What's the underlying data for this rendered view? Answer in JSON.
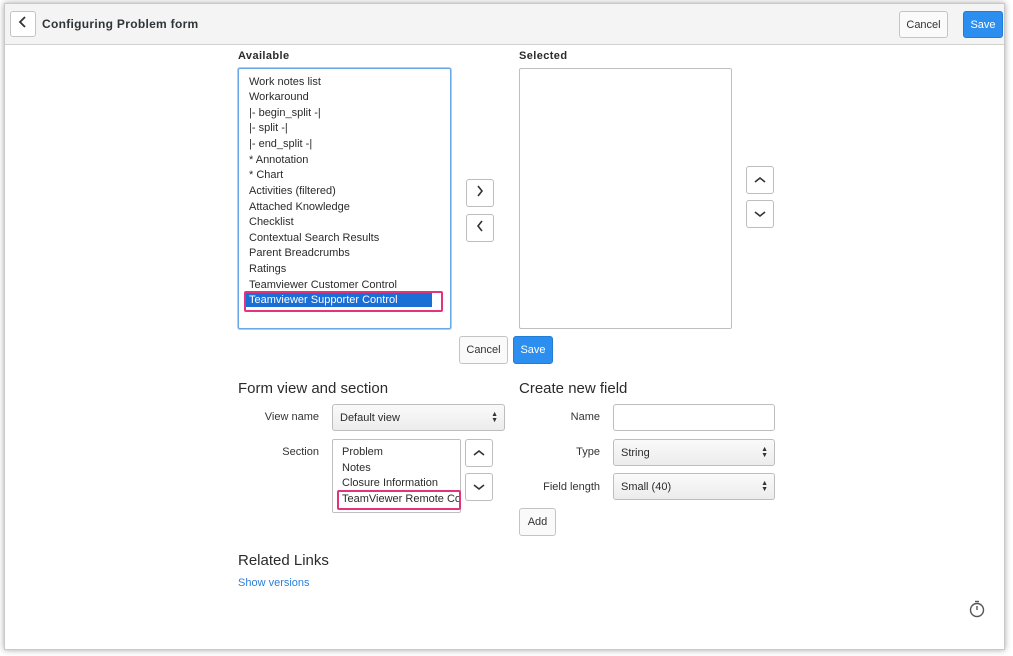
{
  "header": {
    "title": "Configuring Problem form",
    "cancel_label": "Cancel",
    "save_label": "Save"
  },
  "slush": {
    "available_label": "Available",
    "selected_label": "Selected",
    "available_items": [
      "Work notes list",
      "Workaround",
      "|- begin_split -|",
      "|- split -|",
      "|- end_split -|",
      "* Annotation",
      "* Chart",
      "Activities (filtered)",
      "Attached Knowledge",
      "Checklist",
      "Contextual Search Results",
      "Parent Breadcrumbs",
      "Ratings",
      "Teamviewer Customer Control",
      "Teamviewer Supporter Control"
    ],
    "cancel_label": "Cancel",
    "save_label": "Save"
  },
  "form_view": {
    "heading": "Form view and section",
    "view_name_label": "View name",
    "view_name_value": "Default view",
    "section_label": "Section",
    "sections": [
      "Problem",
      "Notes",
      "Closure Information",
      "TeamViewer Remote Con"
    ]
  },
  "new_field": {
    "heading": "Create new field",
    "name_label": "Name",
    "name_value": "",
    "type_label": "Type",
    "type_value": "String",
    "length_label": "Field length",
    "length_value": "Small (40)",
    "add_label": "Add"
  },
  "related": {
    "heading": "Related Links",
    "link": "Show versions"
  },
  "colors": {
    "primary": "#2c8ff0",
    "selection": "#1a6fd6",
    "highlight": "#e3337d",
    "link": "#2c7fd8"
  }
}
